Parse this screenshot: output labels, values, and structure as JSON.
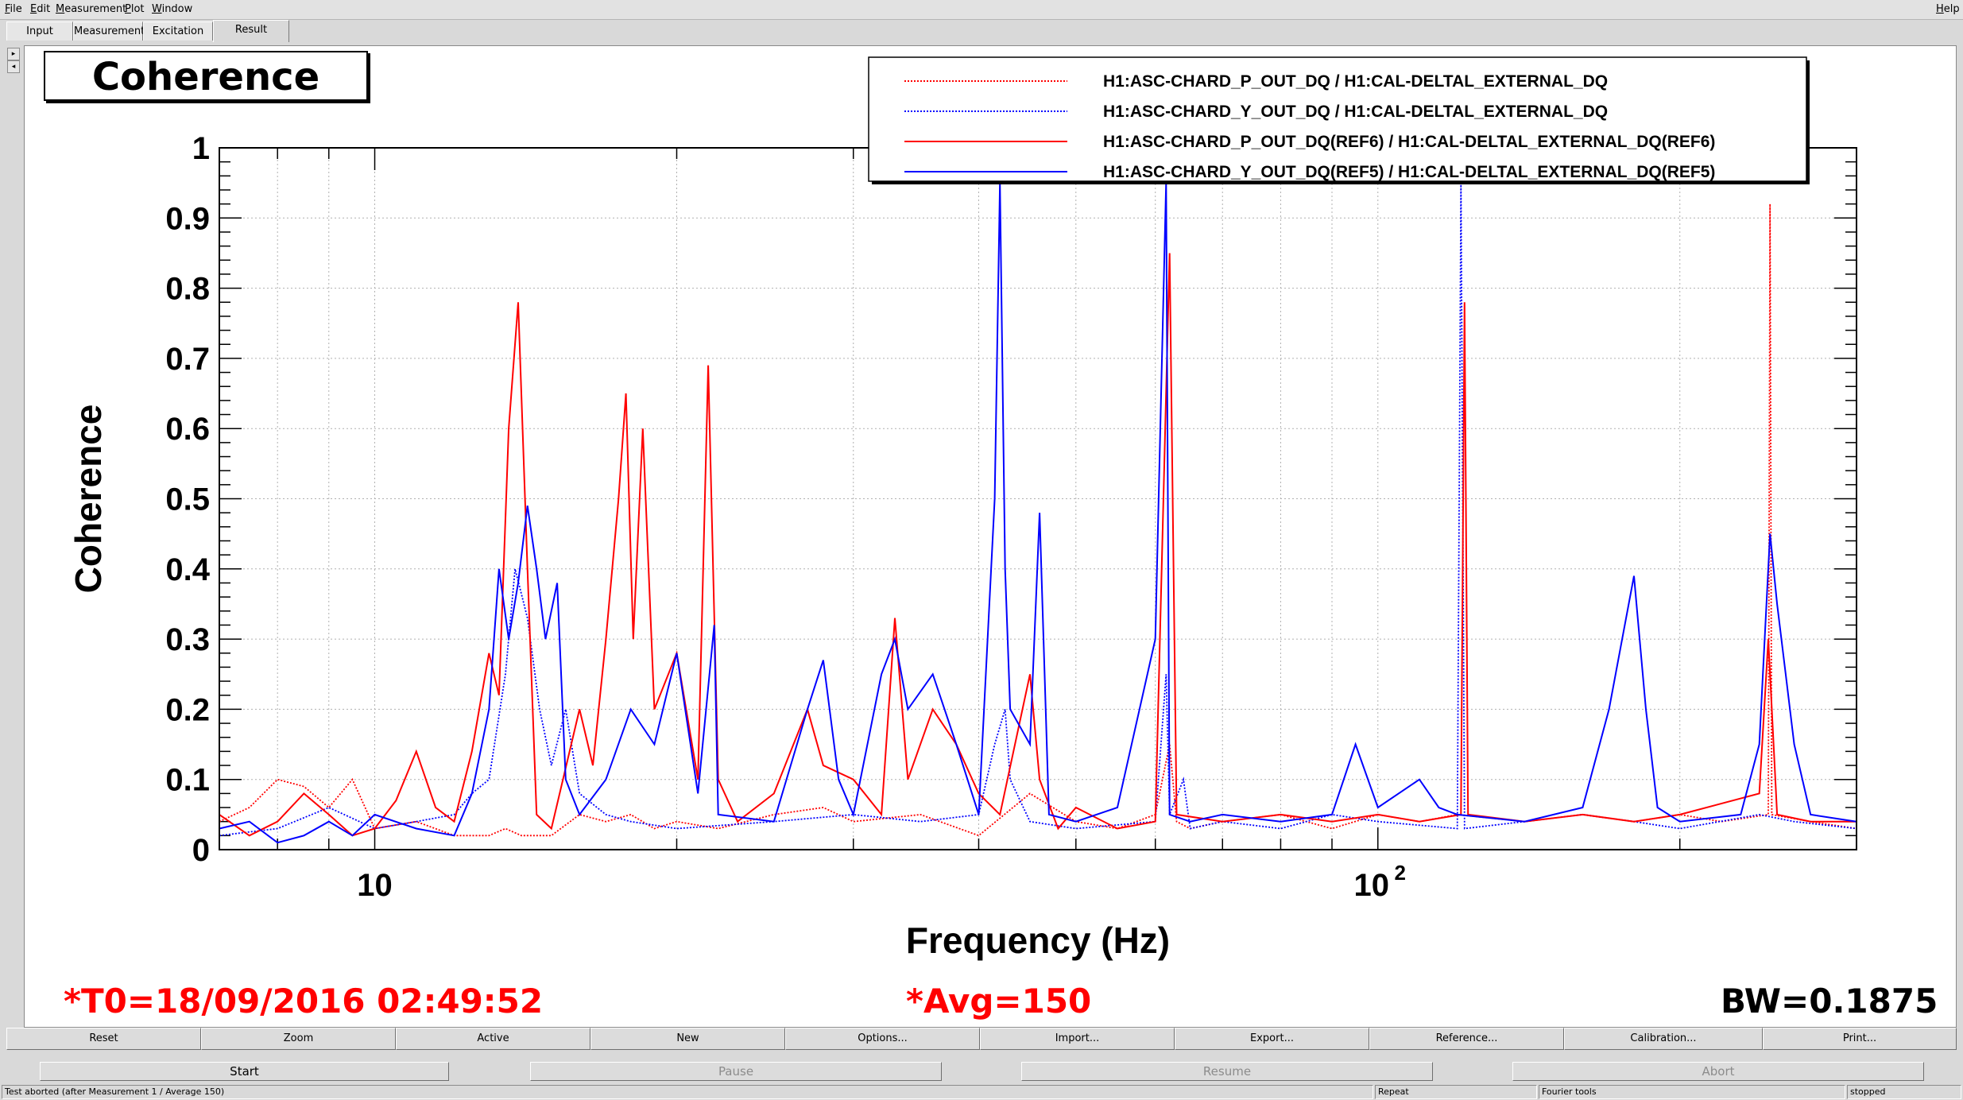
{
  "menubar": {
    "items": [
      "File",
      "Edit",
      "Measurement",
      "Plot",
      "Window"
    ],
    "help": "Help"
  },
  "tabs": [
    {
      "label": "Input"
    },
    {
      "label": "Measurement"
    },
    {
      "label": "Excitation"
    },
    {
      "label": "Result"
    }
  ],
  "plot": {
    "title": "Coherence",
    "t0": "*T0=18/09/2016 02:49:52",
    "avg": "*Avg=150",
    "bw": "BW=0.1875"
  },
  "chart_data": {
    "type": "line",
    "xlabel": "Frequency (Hz)",
    "ylabel": "Coherence",
    "xscale": "log",
    "xlim": [
      7,
      300
    ],
    "ylim": [
      0,
      1
    ],
    "x_ticks": [
      "10",
      "10^2"
    ],
    "y_ticks": [
      "0",
      "0.1",
      "0.2",
      "0.3",
      "0.4",
      "0.5",
      "0.6",
      "0.7",
      "0.8",
      "0.9",
      "1"
    ],
    "grid": true,
    "legend_position": "top-right",
    "series": [
      {
        "name": "H1:ASC-CHARD_P_OUT_DQ / H1:CAL-DELTAL_EXTERNAL_DQ",
        "color": "#ff0000",
        "style": "dotted",
        "points": [
          [
            7,
            0.04
          ],
          [
            7.5,
            0.06
          ],
          [
            8,
            0.1
          ],
          [
            8.5,
            0.09
          ],
          [
            9,
            0.06
          ],
          [
            9.5,
            0.1
          ],
          [
            10,
            0.03
          ],
          [
            11,
            0.04
          ],
          [
            12,
            0.02
          ],
          [
            13,
            0.02
          ],
          [
            13.5,
            0.03
          ],
          [
            14,
            0.02
          ],
          [
            15,
            0.02
          ],
          [
            16,
            0.05
          ],
          [
            17,
            0.04
          ],
          [
            18,
            0.05
          ],
          [
            19,
            0.03
          ],
          [
            20,
            0.04
          ],
          [
            22,
            0.03
          ],
          [
            25,
            0.05
          ],
          [
            28,
            0.06
          ],
          [
            30,
            0.04
          ],
          [
            35,
            0.05
          ],
          [
            40,
            0.02
          ],
          [
            45,
            0.08
          ],
          [
            50,
            0.04
          ],
          [
            55,
            0.03
          ],
          [
            60,
            0.05
          ],
          [
            62,
            0.15
          ],
          [
            63,
            0.04
          ],
          [
            65,
            0.03
          ],
          [
            70,
            0.04
          ],
          [
            80,
            0.05
          ],
          [
            90,
            0.03
          ],
          [
            100,
            0.05
          ],
          [
            110,
            0.04
          ],
          [
            120,
            0.05
          ],
          [
            140,
            0.04
          ],
          [
            160,
            0.05
          ],
          [
            180,
            0.04
          ],
          [
            200,
            0.05
          ],
          [
            220,
            0.04
          ],
          [
            245,
            0.05
          ],
          [
            246,
            0.92
          ],
          [
            247,
            0.05
          ],
          [
            270,
            0.04
          ],
          [
            300,
            0.03
          ]
        ]
      },
      {
        "name": "H1:ASC-CHARD_Y_OUT_DQ / H1:CAL-DELTAL_EXTERNAL_DQ",
        "color": "#0000ff",
        "style": "dotted",
        "points": [
          [
            7,
            0.02
          ],
          [
            8,
            0.03
          ],
          [
            9,
            0.06
          ],
          [
            10,
            0.03
          ],
          [
            11,
            0.04
          ],
          [
            12,
            0.05
          ],
          [
            12.5,
            0.08
          ],
          [
            13,
            0.1
          ],
          [
            13.5,
            0.25
          ],
          [
            13.8,
            0.4
          ],
          [
            14.2,
            0.33
          ],
          [
            14.6,
            0.2
          ],
          [
            15,
            0.12
          ],
          [
            15.5,
            0.2
          ],
          [
            16,
            0.08
          ],
          [
            17,
            0.05
          ],
          [
            18,
            0.04
          ],
          [
            20,
            0.03
          ],
          [
            25,
            0.04
          ],
          [
            30,
            0.05
          ],
          [
            35,
            0.04
          ],
          [
            40,
            0.05
          ],
          [
            41.5,
            0.15
          ],
          [
            42.5,
            0.2
          ],
          [
            43,
            0.1
          ],
          [
            45,
            0.04
          ],
          [
            50,
            0.03
          ],
          [
            60,
            0.04
          ],
          [
            61.5,
            0.25
          ],
          [
            62,
            0.05
          ],
          [
            64,
            0.1
          ],
          [
            65,
            0.03
          ],
          [
            70,
            0.04
          ],
          [
            80,
            0.03
          ],
          [
            90,
            0.05
          ],
          [
            100,
            0.04
          ],
          [
            120,
            0.03
          ],
          [
            121,
            0.95
          ],
          [
            122,
            0.03
          ],
          [
            140,
            0.04
          ],
          [
            160,
            0.05
          ],
          [
            180,
            0.04
          ],
          [
            200,
            0.03
          ],
          [
            240,
            0.05
          ],
          [
            260,
            0.04
          ],
          [
            300,
            0.03
          ]
        ]
      },
      {
        "name": "H1:ASC-CHARD_P_OUT_DQ(REF6) / H1:CAL-DELTAL_EXTERNAL_DQ(REF6)",
        "color": "#ff0000",
        "style": "solid",
        "points": [
          [
            7,
            0.05
          ],
          [
            7.5,
            0.02
          ],
          [
            8,
            0.04
          ],
          [
            8.5,
            0.08
          ],
          [
            9,
            0.05
          ],
          [
            9.5,
            0.02
          ],
          [
            10,
            0.03
          ],
          [
            10.5,
            0.07
          ],
          [
            11,
            0.14
          ],
          [
            11.5,
            0.06
          ],
          [
            12,
            0.04
          ],
          [
            12.5,
            0.14
          ],
          [
            13,
            0.28
          ],
          [
            13.3,
            0.22
          ],
          [
            13.6,
            0.6
          ],
          [
            13.9,
            0.78
          ],
          [
            14.2,
            0.4
          ],
          [
            14.5,
            0.05
          ],
          [
            15,
            0.03
          ],
          [
            16,
            0.2
          ],
          [
            16.5,
            0.12
          ],
          [
            17,
            0.3
          ],
          [
            17.5,
            0.5
          ],
          [
            17.8,
            0.65
          ],
          [
            18.1,
            0.3
          ],
          [
            18.5,
            0.6
          ],
          [
            19,
            0.2
          ],
          [
            20,
            0.28
          ],
          [
            21,
            0.1
          ],
          [
            21.5,
            0.69
          ],
          [
            22,
            0.1
          ],
          [
            23,
            0.04
          ],
          [
            25,
            0.08
          ],
          [
            27,
            0.2
          ],
          [
            28,
            0.12
          ],
          [
            30,
            0.1
          ],
          [
            32,
            0.05
          ],
          [
            33,
            0.33
          ],
          [
            34,
            0.1
          ],
          [
            36,
            0.2
          ],
          [
            38,
            0.15
          ],
          [
            40,
            0.08
          ],
          [
            42,
            0.05
          ],
          [
            45,
            0.25
          ],
          [
            46,
            0.1
          ],
          [
            48,
            0.03
          ],
          [
            50,
            0.06
          ],
          [
            55,
            0.03
          ],
          [
            60,
            0.04
          ],
          [
            62,
            0.85
          ],
          [
            63,
            0.05
          ],
          [
            70,
            0.04
          ],
          [
            80,
            0.05
          ],
          [
            90,
            0.04
          ],
          [
            100,
            0.05
          ],
          [
            110,
            0.04
          ],
          [
            121,
            0.05
          ],
          [
            122,
            0.78
          ],
          [
            123,
            0.05
          ],
          [
            140,
            0.04
          ],
          [
            160,
            0.05
          ],
          [
            180,
            0.04
          ],
          [
            200,
            0.05
          ],
          [
            240,
            0.08
          ],
          [
            245,
            0.3
          ],
          [
            250,
            0.05
          ],
          [
            270,
            0.04
          ],
          [
            300,
            0.04
          ]
        ]
      },
      {
        "name": "H1:ASC-CHARD_Y_OUT_DQ(REF5) / H1:CAL-DELTAL_EXTERNAL_DQ(REF5)",
        "color": "#0000ff",
        "style": "solid",
        "points": [
          [
            7,
            0.03
          ],
          [
            7.5,
            0.04
          ],
          [
            8,
            0.01
          ],
          [
            8.5,
            0.02
          ],
          [
            9,
            0.04
          ],
          [
            9.5,
            0.02
          ],
          [
            10,
            0.05
          ],
          [
            11,
            0.03
          ],
          [
            12,
            0.02
          ],
          [
            12.5,
            0.08
          ],
          [
            13,
            0.2
          ],
          [
            13.3,
            0.4
          ],
          [
            13.6,
            0.3
          ],
          [
            13.9,
            0.38
          ],
          [
            14.2,
            0.49
          ],
          [
            14.5,
            0.4
          ],
          [
            14.8,
            0.3
          ],
          [
            15.2,
            0.38
          ],
          [
            15.5,
            0.1
          ],
          [
            16,
            0.05
          ],
          [
            17,
            0.1
          ],
          [
            18,
            0.2
          ],
          [
            19,
            0.15
          ],
          [
            20,
            0.28
          ],
          [
            21,
            0.08
          ],
          [
            21.8,
            0.32
          ],
          [
            22,
            0.05
          ],
          [
            25,
            0.04
          ],
          [
            27,
            0.2
          ],
          [
            28,
            0.27
          ],
          [
            29,
            0.1
          ],
          [
            30,
            0.05
          ],
          [
            32,
            0.25
          ],
          [
            33,
            0.3
          ],
          [
            34,
            0.2
          ],
          [
            36,
            0.25
          ],
          [
            38,
            0.15
          ],
          [
            40,
            0.05
          ],
          [
            41.5,
            0.5
          ],
          [
            42,
            0.95
          ],
          [
            42.5,
            0.4
          ],
          [
            43,
            0.2
          ],
          [
            45,
            0.15
          ],
          [
            46,
            0.48
          ],
          [
            47,
            0.05
          ],
          [
            50,
            0.04
          ],
          [
            55,
            0.06
          ],
          [
            60,
            0.3
          ],
          [
            61.5,
            0.95
          ],
          [
            62,
            0.05
          ],
          [
            65,
            0.04
          ],
          [
            70,
            0.05
          ],
          [
            80,
            0.04
          ],
          [
            90,
            0.05
          ],
          [
            95,
            0.15
          ],
          [
            100,
            0.06
          ],
          [
            110,
            0.1
          ],
          [
            115,
            0.06
          ],
          [
            120,
            0.05
          ],
          [
            140,
            0.04
          ],
          [
            160,
            0.06
          ],
          [
            170,
            0.2
          ],
          [
            180,
            0.39
          ],
          [
            185,
            0.2
          ],
          [
            190,
            0.06
          ],
          [
            200,
            0.04
          ],
          [
            230,
            0.05
          ],
          [
            240,
            0.15
          ],
          [
            246,
            0.45
          ],
          [
            250,
            0.35
          ],
          [
            255,
            0.25
          ],
          [
            260,
            0.15
          ],
          [
            270,
            0.05
          ],
          [
            300,
            0.04
          ]
        ]
      }
    ]
  },
  "toolbar": {
    "buttons": [
      "Reset",
      "Zoom",
      "Active",
      "New",
      "Options...",
      "Import...",
      "Export...",
      "Reference...",
      "Calibration...",
      "Print..."
    ]
  },
  "controls": {
    "start": "Start",
    "pause": "Pause",
    "resume": "Resume",
    "abort": "Abort"
  },
  "statusbar": {
    "message": "Test aborted (after Measurement 1 / Average 150)",
    "repeat": "Repeat",
    "fourier": "Fourier tools",
    "state": "stopped"
  }
}
